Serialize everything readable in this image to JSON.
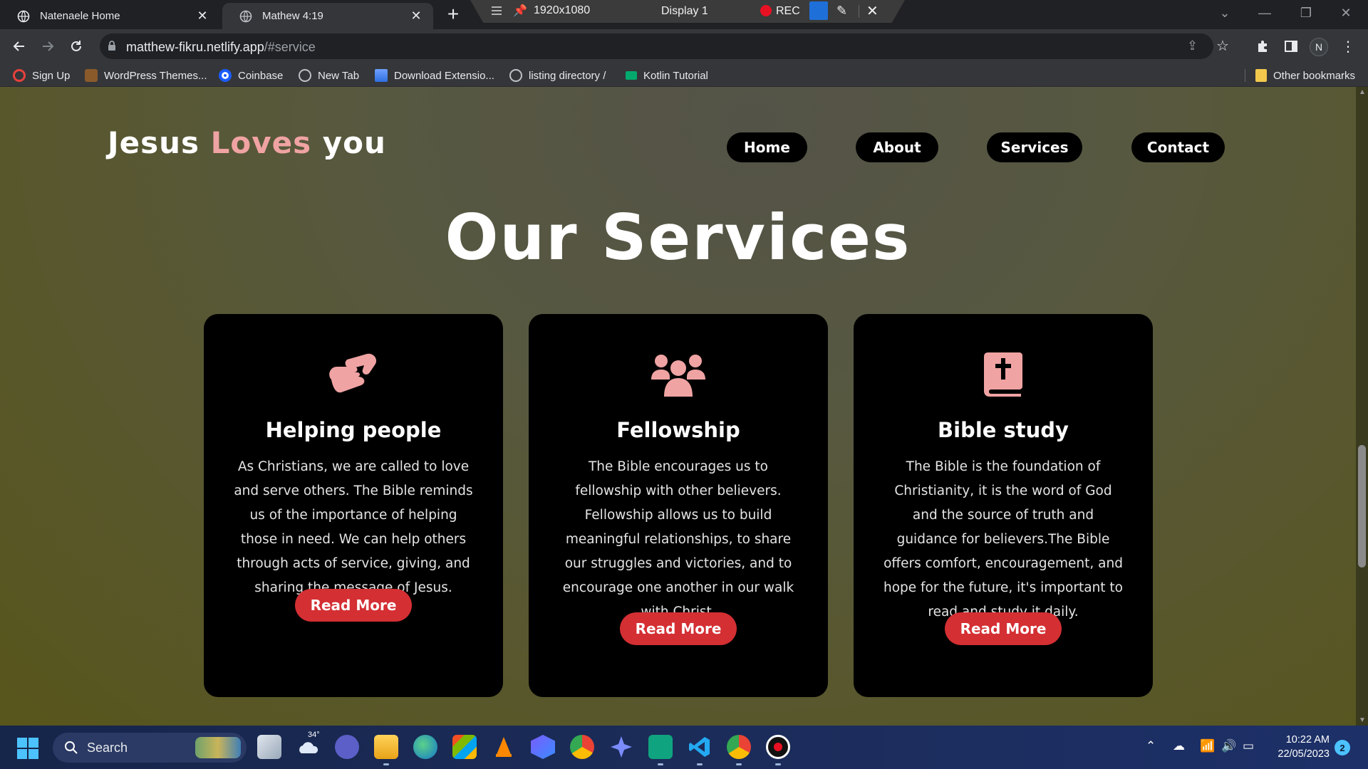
{
  "browser": {
    "tabs": [
      {
        "title": "Natenaele Home",
        "active": false,
        "icon": "globe-icon"
      },
      {
        "title": "Mathew 4:19",
        "active": true,
        "icon": "globe-icon"
      }
    ],
    "new_tab_label": "+",
    "address": {
      "host": "matthew-fikru.netlify.app",
      "path": "/#service"
    },
    "profile_initial": "N",
    "bookmarks": [
      {
        "label": "Sign Up",
        "icon": "opera-icon"
      },
      {
        "label": "WordPress Themes...",
        "icon": "wordpress-themes-icon"
      },
      {
        "label": "Coinbase",
        "icon": "coinbase-icon"
      },
      {
        "label": "New Tab",
        "icon": "globe-icon"
      },
      {
        "label": "Download Extensio...",
        "icon": "download-extension-icon"
      },
      {
        "label": "listing directory /",
        "icon": "globe-icon"
      },
      {
        "label": "Kotlin Tutorial",
        "icon": "w3schools-icon"
      }
    ],
    "other_bookmarks": "Other bookmarks"
  },
  "recorder": {
    "resolution": "1920x1080",
    "display": "Display 1",
    "rec_label": "REC"
  },
  "site": {
    "title_parts": [
      "Jesus ",
      "Loves",
      " you"
    ],
    "accent_color": "#f0a3a3",
    "nav": [
      "Home",
      "About",
      "Services",
      "Contact"
    ],
    "section_heading": "Our Services",
    "button_color": "#d42f33",
    "cards": [
      {
        "icon": "handshake-icon",
        "title": "Helping people",
        "text": "As Christians, we are called to love and serve others. The Bible reminds us of the importance of helping those in need. We can help others through acts of service, giving, and sharing the message of Jesus.",
        "button": "Read More"
      },
      {
        "icon": "people-group-icon",
        "title": "Fellowship",
        "text": "The Bible encourages us to fellowship with other believers. Fellowship allows us to build meaningful relationships, to share our struggles and victories, and to encourage one another in our walk with Christ.",
        "button": "Read More"
      },
      {
        "icon": "bible-icon",
        "title": "Bible study",
        "text": "The Bible is the foundation of Christianity, it is the word of God and the source of truth and guidance for believers.The Bible offers comfort, encouragement, and hope for the future, it's important to read and study it daily.",
        "button": "Read More"
      }
    ]
  },
  "taskbar": {
    "search_label": "Search",
    "weather_temp": "34°",
    "time": "10:22 AM",
    "date": "22/05/2023",
    "notification_count": "2"
  }
}
